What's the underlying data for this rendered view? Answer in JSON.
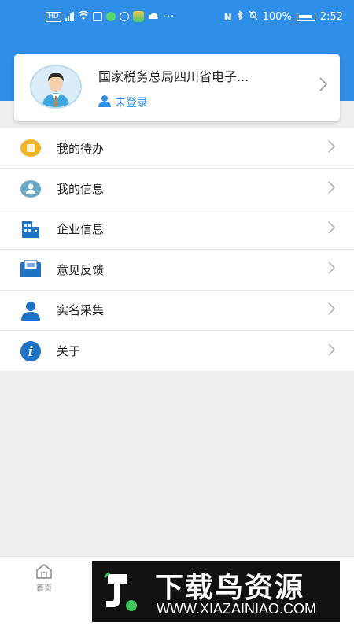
{
  "status_bar": {
    "battery_percent": "100%",
    "time": "2:52",
    "hd_badge": "HD"
  },
  "profile": {
    "org_name": "国家税务总局四川省电子...",
    "login_status": "未登录",
    "avatar_icon": "businessman-avatar"
  },
  "menu": {
    "items": [
      {
        "label": "我的待办",
        "icon": "todo-icon",
        "color": "#f0b429"
      },
      {
        "label": "我的信息",
        "icon": "person-circle-icon",
        "color": "#6aa8c8"
      },
      {
        "label": "企业信息",
        "icon": "building-icon",
        "color": "#1f73c4"
      },
      {
        "label": "意见反馈",
        "icon": "feedback-envelope-icon",
        "color": "#1f73c4"
      },
      {
        "label": "实名采集",
        "icon": "person-icon",
        "color": "#1f73c4"
      },
      {
        "label": "关于",
        "icon": "info-icon",
        "color": "#1f73c4"
      }
    ]
  },
  "tabbar": {
    "home_label": "首页"
  },
  "watermark": {
    "title": "下载鸟资源",
    "url": "WWW.XIAZAINIAO.COM"
  },
  "colors": {
    "accent": "#2f8ee6",
    "background": "#efefef"
  }
}
